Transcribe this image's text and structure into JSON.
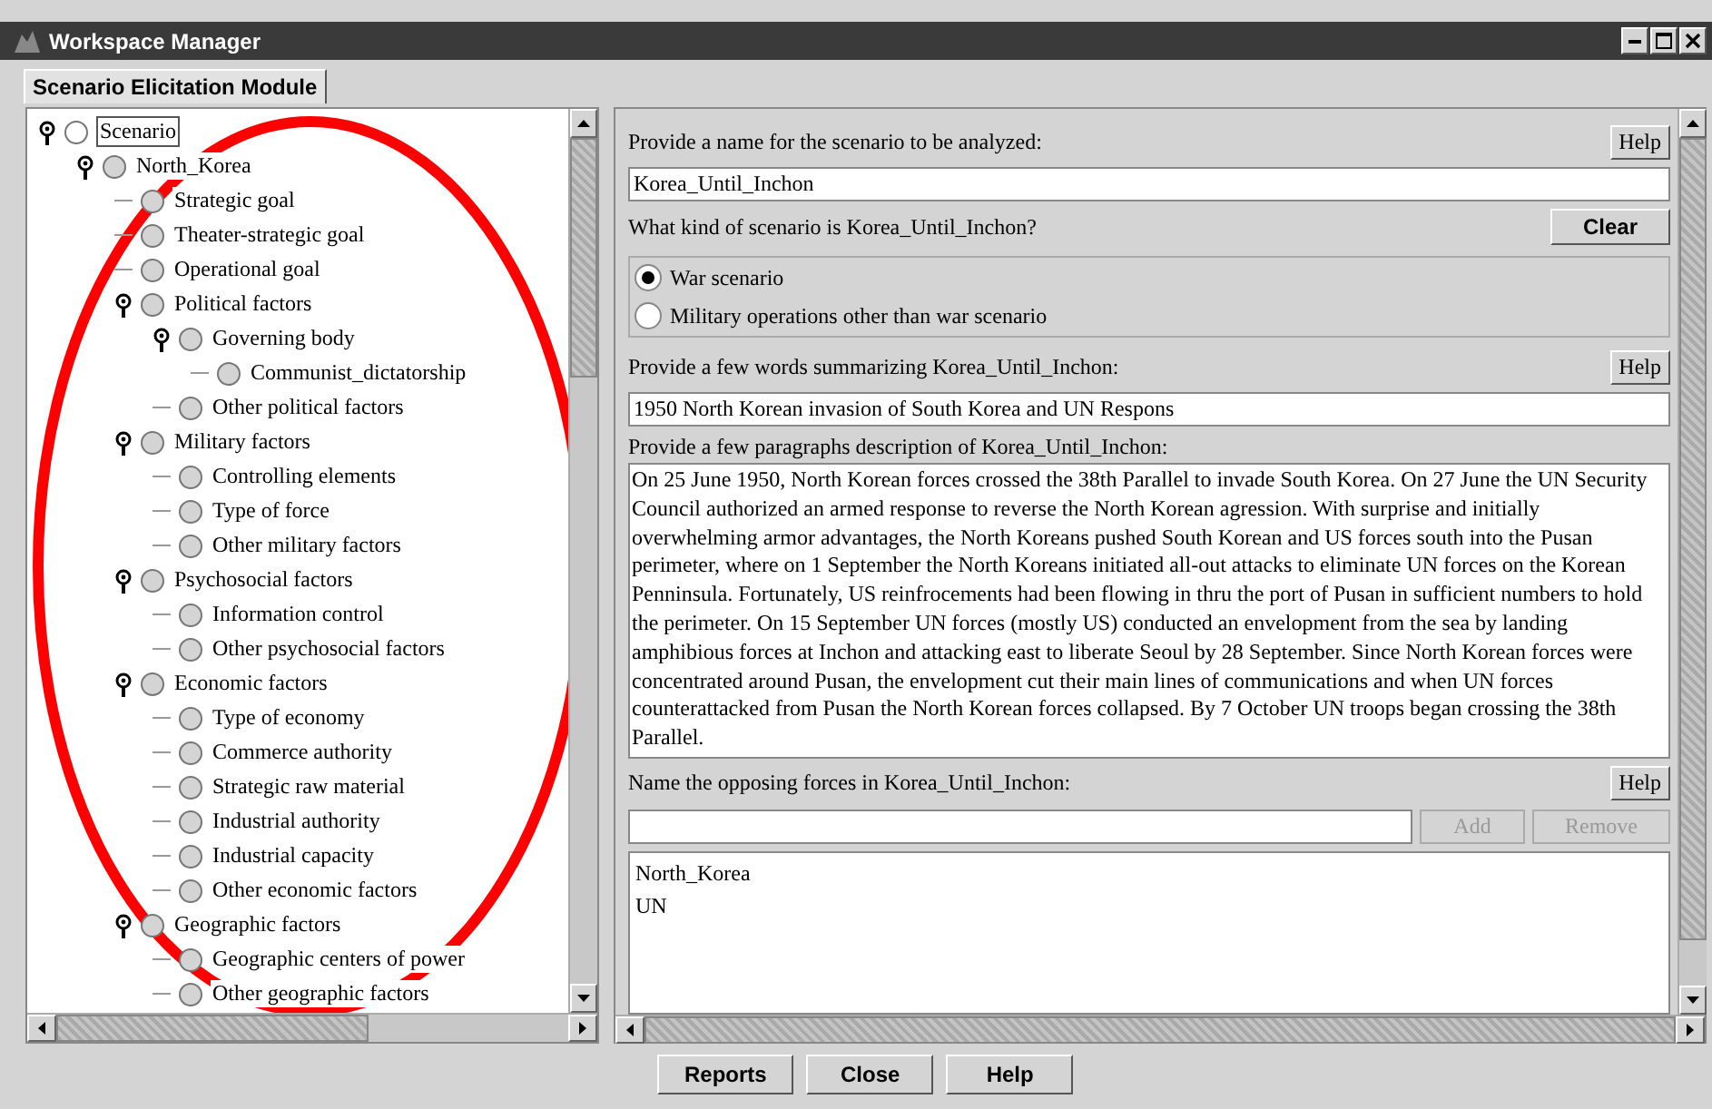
{
  "window": {
    "title": "Workspace Manager"
  },
  "tabs": [
    {
      "label": "Scenario Elicitation Module",
      "selected": true
    }
  ],
  "tree": [
    {
      "label": "Scenario",
      "selected": true,
      "expanded": true,
      "children": [
        {
          "label": "North_Korea",
          "selected": false,
          "expanded": true,
          "children": [
            {
              "label": "Strategic goal",
              "selected": false
            },
            {
              "label": "Theater-strategic goal",
              "selected": false
            },
            {
              "label": "Operational goal",
              "selected": false
            },
            {
              "label": "Political factors",
              "selected": false,
              "expanded": true,
              "children": [
                {
                  "label": "Governing body",
                  "selected": false,
                  "expanded": true,
                  "children": [
                    {
                      "label": "Communist_dictatorship",
                      "selected": false
                    }
                  ]
                },
                {
                  "label": "Other political factors",
                  "selected": false
                }
              ]
            },
            {
              "label": "Military factors",
              "selected": false,
              "expanded": true,
              "children": [
                {
                  "label": "Controlling elements",
                  "selected": false
                },
                {
                  "label": "Type of force",
                  "selected": false
                },
                {
                  "label": "Other military factors",
                  "selected": false
                }
              ]
            },
            {
              "label": "Psychosocial factors",
              "selected": false,
              "expanded": true,
              "children": [
                {
                  "label": "Information control",
                  "selected": false
                },
                {
                  "label": "Other psychosocial factors",
                  "selected": false
                }
              ]
            },
            {
              "label": "Economic factors",
              "selected": false,
              "expanded": true,
              "children": [
                {
                  "label": "Type of economy",
                  "selected": false
                },
                {
                  "label": "Commerce authority",
                  "selected": false
                },
                {
                  "label": "Strategic raw material",
                  "selected": false
                },
                {
                  "label": "Industrial authority",
                  "selected": false
                },
                {
                  "label": "Industrial capacity",
                  "selected": false
                },
                {
                  "label": "Other economic factors",
                  "selected": false
                }
              ]
            },
            {
              "label": "Geographic factors",
              "selected": false,
              "expanded": true,
              "children": [
                {
                  "label": "Geographic centers of power",
                  "selected": false
                },
                {
                  "label": "Other geographic factors",
                  "selected": false
                }
              ]
            }
          ]
        }
      ]
    }
  ],
  "name_section": {
    "prompt": "Provide a name for the scenario to be analyzed:",
    "help": "Help",
    "value": "Korea_Until_Inchon"
  },
  "kind_section": {
    "prompt": "What kind of scenario is Korea_Until_Inchon?",
    "clear": "Clear",
    "options": [
      {
        "label": "War scenario",
        "selected": true
      },
      {
        "label": "Military operations other than war scenario",
        "selected": false
      }
    ]
  },
  "summary_section": {
    "prompt": "Provide a few words summarizing Korea_Until_Inchon:",
    "help": "Help",
    "value": "1950 North Korean invasion of South Korea and UN Respons"
  },
  "description_section": {
    "prompt": "Provide a few paragraphs description of Korea_Until_Inchon:",
    "value": "On 25 June 1950, North Korean forces crossed the 38th Parallel to invade South Korea.  On 27 June the UN Security Council authorized an armed response to reverse the North Korean agression.  With surprise and initially overwhelming armor advantages, the North Koreans pushed South Korean and US forces south into the Pusan perimeter, where on 1 September the North Koreans initiated all-out attacks to eliminate UN forces on the Korean Penninsula.  Fortunately, US reinfrocements had been flowing in thru the port of Pusan in sufficient numbers to hold the perimeter.  On 15 September UN forces (mostly US) conducted an envelopment from the sea by landing amphibious forces at Inchon and attacking east to liberate Seoul by 28 September.  Since North Korean forces were concentrated around Pusan, the envelopment cut their main lines of communications and when UN forces counterattacked from Pusan the North Korean forces collapsed.  By 7 October UN troops began crossing the 38th Parallel."
  },
  "forces_section": {
    "prompt": "Name the opposing forces in Korea_Until_Inchon:",
    "help": "Help",
    "add": {
      "label": "Add",
      "disabled": true
    },
    "remove": {
      "label": "Remove",
      "disabled": true
    },
    "items": [
      "North_Korea",
      "UN"
    ]
  },
  "buttons": [
    "Reports",
    "Close",
    "Help"
  ]
}
